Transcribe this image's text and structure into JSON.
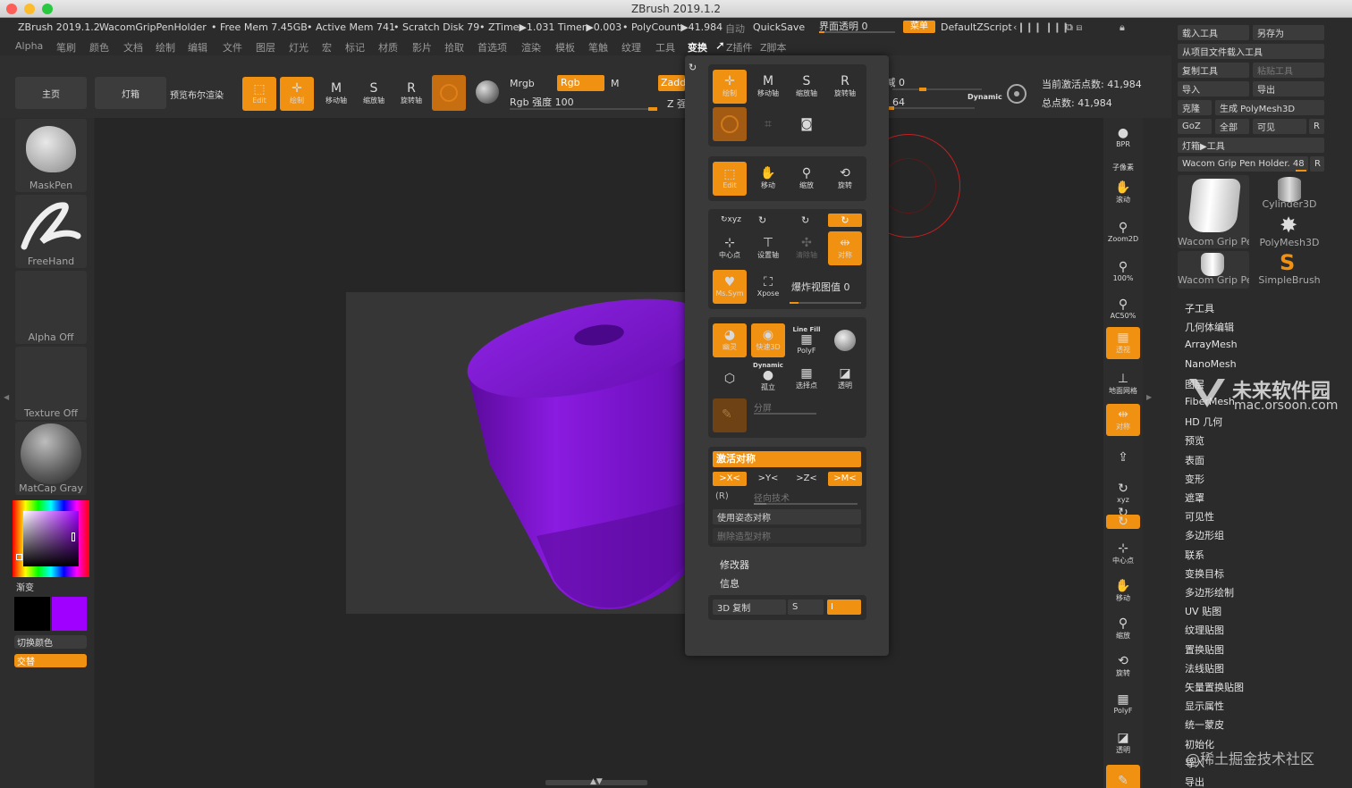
{
  "window": {
    "title": "ZBrush 2019.1.2"
  },
  "status": {
    "app": "ZBrush 2019.1.2",
    "doc": "WacomGripPenHolder",
    "free_mem": "• Free Mem 7.45GB",
    "active_mem": "• Active Mem 741",
    "scratch": "• Scratch Disk 79",
    "ztime": "• ZTime▶1.031 Timer▶0.003",
    "polycount": "• PolyCount▶41.984",
    "auto": "自动",
    "quicksave": "QuickSave",
    "interface_transparency": "界面透明 0",
    "menu_label": "菜单",
    "default_script": "DefaultZScript"
  },
  "menu": [
    "Alpha",
    "笔刷",
    "颜色",
    "文档",
    "绘制",
    "编辑",
    "文件",
    "图层",
    "灯光",
    "宏",
    "标记",
    "材质",
    "影片",
    "拾取",
    "首选项",
    "渲染",
    "模板",
    "笔触",
    "纹理",
    "工具",
    "变换",
    "Z插件",
    "Z脚本"
  ],
  "active_menu_index": 20,
  "shelf": {
    "home": "主页",
    "lightbox": "灯箱",
    "preview_render": "预览布尔渲染",
    "edit": "Edit",
    "draw": "绘制",
    "move": "移动轴",
    "scale": "缩放轴",
    "rotate": "旋转轴",
    "mrgb": "Mrgb",
    "rgb": "Rgb",
    "m": "M",
    "zadd": "Zadd",
    "rgb_intensity": "Rgb 强度 100",
    "z_intensity": "Z 强度 25",
    "focal_shift": "焦点衰减 0",
    "draw_size": "绘制大小 64",
    "dynamic": "Dynamic",
    "active_points": "当前激活点数: 41,984",
    "total_points": "总点数: 41,984"
  },
  "left": {
    "brush": "MaskPen",
    "stroke": "FreeHand",
    "alpha": "Alpha Off",
    "texture": "Texture Off",
    "material": "MatCap Gray",
    "gradient": "渐变",
    "switch_color": "切换颜色",
    "alternate": "交替",
    "main_color": "#000000",
    "secondary_color": "#a000ff"
  },
  "right_toolbar": [
    "BPR",
    "子像素",
    "滚动",
    "Zoom2D",
    "100%",
    "AC50%",
    "透视",
    "地面网格",
    "对称",
    "",
    "xyz",
    "",
    "",
    "中心点",
    "移动",
    "缩放",
    "旋转",
    "PolyF",
    "透明",
    ""
  ],
  "right_panel": {
    "load_tool": "载入工具",
    "save_as": "另存为",
    "load_from_project": "从项目文件载入工具",
    "copy_tool": "复制工具",
    "paste_tool": "粘贴工具",
    "import": "导入",
    "export": "导出",
    "clone": "克隆",
    "make_polymesh": "生成 PolyMesh3D",
    "goz": "GoZ",
    "all": "全部",
    "visible": "可见",
    "r": "R",
    "lightbox_tools": "灯箱▶工具",
    "current_tool": "Wacom Grip Pen Holder. 48",
    "tools": [
      "Wacom Grip Pe",
      "Cylinder3D",
      "PolyMesh3D",
      "Wacom Grip Pe",
      "SimpleBrush"
    ],
    "subpalettes": [
      "子工具",
      "几何体编辑",
      "ArrayMesh",
      "NanoMesh",
      "图层",
      "FiberMesh",
      "HD 几何",
      "预览",
      "表面",
      "变形",
      "遮罩",
      "可见性",
      "多边形组",
      "联系",
      "变换目标",
      "多边形绘制",
      "UV 贴图",
      "纹理贴图",
      "置换贴图",
      "法线贴图",
      "矢量置换贴图",
      "显示属性",
      "统一蒙皮",
      "初始化",
      "导入",
      "导出"
    ]
  },
  "transform_popup": {
    "move": "移动",
    "scale": "缩放",
    "rotate": "旋转",
    "draw": "绘制",
    "move_axis": "移动轴",
    "scale_axis": "缩放轴",
    "rotate_axis": "旋转轴",
    "edit": "Edit",
    "xyz": "xyz",
    "center": "中心点",
    "set_pivot": "设置轴",
    "clear_pivot": "清除轴",
    "symmetry": "对称",
    "ms_sym": "Ms.Sym",
    "xpose": "Xpose",
    "explode_value": "爆炸视图值 0",
    "line_fill": "Line Fill",
    "polyf": "PolyF",
    "quick3d": "快速3D",
    "solo": "孤立",
    "dynamic": "Dynamic",
    "transparent": "透明",
    "ghost": "幽灵",
    "spotlight": "选择点",
    "split": "分屏",
    "activate_symmetry": "激活对称",
    "x": ">X<",
    "y": ">Y<",
    "z": ">Z<",
    "m": ">M<",
    "r": "(R)",
    "radial_count": "径向技术",
    "use_posable": "使用姿态对称",
    "delete_posable": "删除造型对称",
    "modifiers": "修改器",
    "info": "信息",
    "copy3d": "3D 复制",
    "s": "S",
    "i": "I"
  },
  "watermark": {
    "brand": "未来软件园",
    "url": "mac.orsoon.com",
    "community": "@稀土掘金技术社区"
  },
  "colors": {
    "accent": "#f19112",
    "object": "#7b10c8"
  }
}
